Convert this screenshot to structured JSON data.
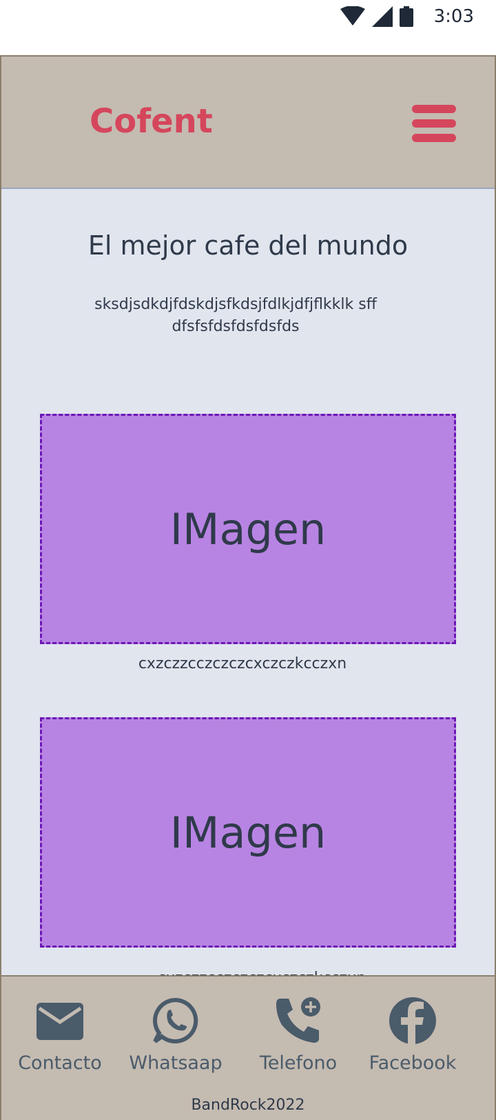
{
  "status_bar": {
    "time": "3:03",
    "icons": [
      "wifi-icon",
      "signal-icon",
      "battery-icon"
    ]
  },
  "header": {
    "brand": "Cofent",
    "menu_icon": "hamburger-menu-icon"
  },
  "main": {
    "headline": "El mejor cafe del mundo",
    "intro_text": "sksdjsdkdjfdskdjsfkdsjfdlkjdfjflkklk sffdfsfsfdsfdsfdsfds",
    "images": [
      {
        "label": "IMagen",
        "caption": "cxzczzcczczczcxczczkcczxn"
      },
      {
        "label": "IMagen",
        "caption": "cxzczzcczczczcxczczkcczxn"
      }
    ]
  },
  "footer": {
    "items": [
      {
        "label": "Contacto",
        "icon": "mail-icon"
      },
      {
        "label": "Whatsaap",
        "icon": "whatsapp-icon"
      },
      {
        "label": "Telefono",
        "icon": "phone-add-icon"
      },
      {
        "label": "Facebook",
        "icon": "facebook-icon"
      }
    ],
    "copyright": "BandRock2022"
  },
  "colors": {
    "brand": "#d5465c",
    "header_bg": "#c4bbb1",
    "content_bg": "#e1e5ee",
    "image_bg": "#b884e3",
    "image_border": "#6b17b5",
    "text": "#2f3a4a",
    "footer_icon": "#4a5b6a"
  }
}
